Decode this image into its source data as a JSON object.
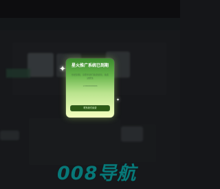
{
  "modal": {
    "title": "星火推广系统已到期",
    "description": "系统到期，请联系我们续费使用，续费请联系",
    "contact_phone": "13888888888",
    "button_label": "联系我们续费"
  },
  "background": {
    "brand_name": "008导航"
  },
  "icons": {
    "sparkle_large": "✦",
    "sparkle_small": "✦"
  },
  "colors": {
    "modal_top": "#3b8a2e",
    "modal_bottom": "#f4ffbf",
    "button": "#2d5b17",
    "brand": "#0aa7a7"
  }
}
